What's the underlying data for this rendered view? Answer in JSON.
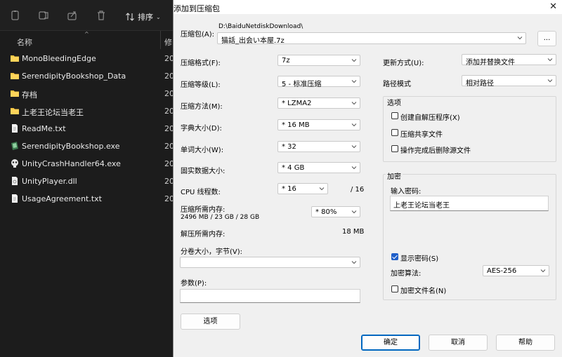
{
  "explorer": {
    "toolbar": {
      "sort_label": "排序"
    },
    "columns": {
      "name": "名称",
      "modified": "修"
    },
    "files": [
      {
        "name": "MonoBleedingEdge",
        "icon": "folder-icon",
        "date": "20"
      },
      {
        "name": "SerendipityBookshop_Data",
        "icon": "folder-icon",
        "date": "20"
      },
      {
        "name": "存档",
        "icon": "folder-icon",
        "date": "20"
      },
      {
        "name": "上老王论坛当老王",
        "icon": "folder-icon",
        "date": "20"
      },
      {
        "name": "ReadMe.txt",
        "icon": "text-file-icon",
        "date": "20"
      },
      {
        "name": "SerendipityBookshop.exe",
        "icon": "app-exe-icon",
        "date": "20"
      },
      {
        "name": "UnityCrashHandler64.exe",
        "icon": "unity-exe-icon",
        "date": "20"
      },
      {
        "name": "UnityPlayer.dll",
        "icon": "dll-file-icon",
        "date": "20"
      },
      {
        "name": "UsageAgreement.txt",
        "icon": "text-file-icon",
        "date": "20"
      }
    ]
  },
  "dialog": {
    "title": "添加到压缩包",
    "archive_label": "压缩包(A):",
    "archive_dir": "D:\\BaiduNetdiskDownload\\",
    "archive_name": "猫話_出会い本屋.7z",
    "browse_label": "...",
    "format_label": "压缩格式(F):",
    "format_value": "7z",
    "level_label": "压缩等级(L):",
    "level_value": "5 - 标准压缩",
    "method_label": "压缩方法(M):",
    "method_value": "* LZMA2",
    "dict_label": "字典大小(D):",
    "dict_value": "* 16 MB",
    "word_label": "单词大小(W):",
    "word_value": "* 32",
    "solid_label": "固实数据大小:",
    "solid_value": "* 4 GB",
    "threads_label": "CPU 线程数:",
    "threads_value": "* 16",
    "threads_total": "/ 16",
    "mem_compress_label": "压缩所需内存:",
    "mem_compress_value": "2496 MB / 23 GB / 28 GB",
    "mem_percent": "* 80%",
    "mem_decompress_label": "解压所需内存:",
    "mem_decompress_value": "18 MB",
    "split_label": "分卷大小，字节(V):",
    "split_value": "",
    "params_label": "参数(P):",
    "params_value": "",
    "options_button": "选项",
    "update_label": "更新方式(U):",
    "update_value": "添加并替换文件",
    "path_label": "路径模式",
    "path_value": "相对路径",
    "options_group": "选项",
    "opt_sfx": "创建自解压程序(X)",
    "opt_shared": "压缩共享文件",
    "opt_delete": "操作完成后删除源文件",
    "encrypt_group": "加密",
    "password_label": "输入密码:",
    "password_value": "上老王论坛当老王",
    "show_password": "显示密码(S)",
    "enc_method_label": "加密算法:",
    "enc_method_value": "AES-256",
    "encrypt_names": "加密文件名(N)",
    "ok": "确定",
    "cancel": "取消",
    "help": "帮助"
  }
}
